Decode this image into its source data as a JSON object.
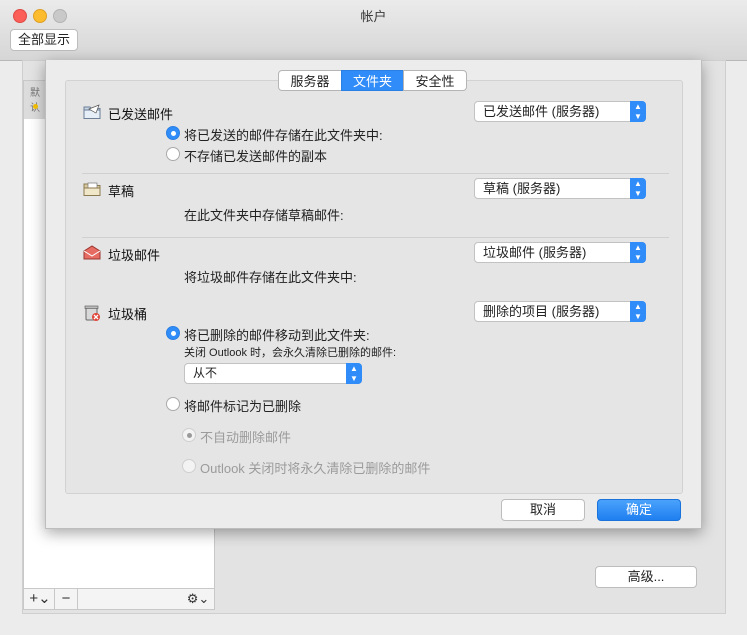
{
  "window": {
    "title": "帐户",
    "show_all": "全部显示"
  },
  "background": {
    "list_header": "默认",
    "add": "+⌄",
    "remove": "−",
    "gear": "⚙⌄",
    "advanced": "高级..."
  },
  "tabs": [
    {
      "label": "服务器"
    },
    {
      "label": "文件夹"
    },
    {
      "label": "安全性"
    }
  ],
  "sent": {
    "title": "已发送邮件",
    "popup": "已发送邮件 (服务器)",
    "opt_store": "将已发送的邮件存储在此文件夹中:",
    "opt_nocopy": "不存储已发送邮件的副本"
  },
  "drafts": {
    "title": "草稿",
    "popup": "草稿 (服务器)",
    "desc": "在此文件夹中存储草稿邮件:"
  },
  "junk": {
    "title": "垃圾邮件",
    "popup": "垃圾邮件 (服务器)",
    "desc": "将垃圾邮件存储在此文件夹中:"
  },
  "trash": {
    "title": "垃圾桶",
    "popup": "删除的项目 (服务器)",
    "opt_move": "将已删除的邮件移动到此文件夹:",
    "close_note": "关闭 Outlook 时，会永久清除已删除的邮件:",
    "never": "从不",
    "opt_mark": "将邮件标记为已删除",
    "sub_noauto": "不自动删除邮件",
    "sub_purge": "Outlook 关闭时将永久清除已删除的邮件"
  },
  "buttons": {
    "cancel": "取消",
    "ok": "确定"
  },
  "colors": {
    "accent": "#2f8cf8"
  }
}
